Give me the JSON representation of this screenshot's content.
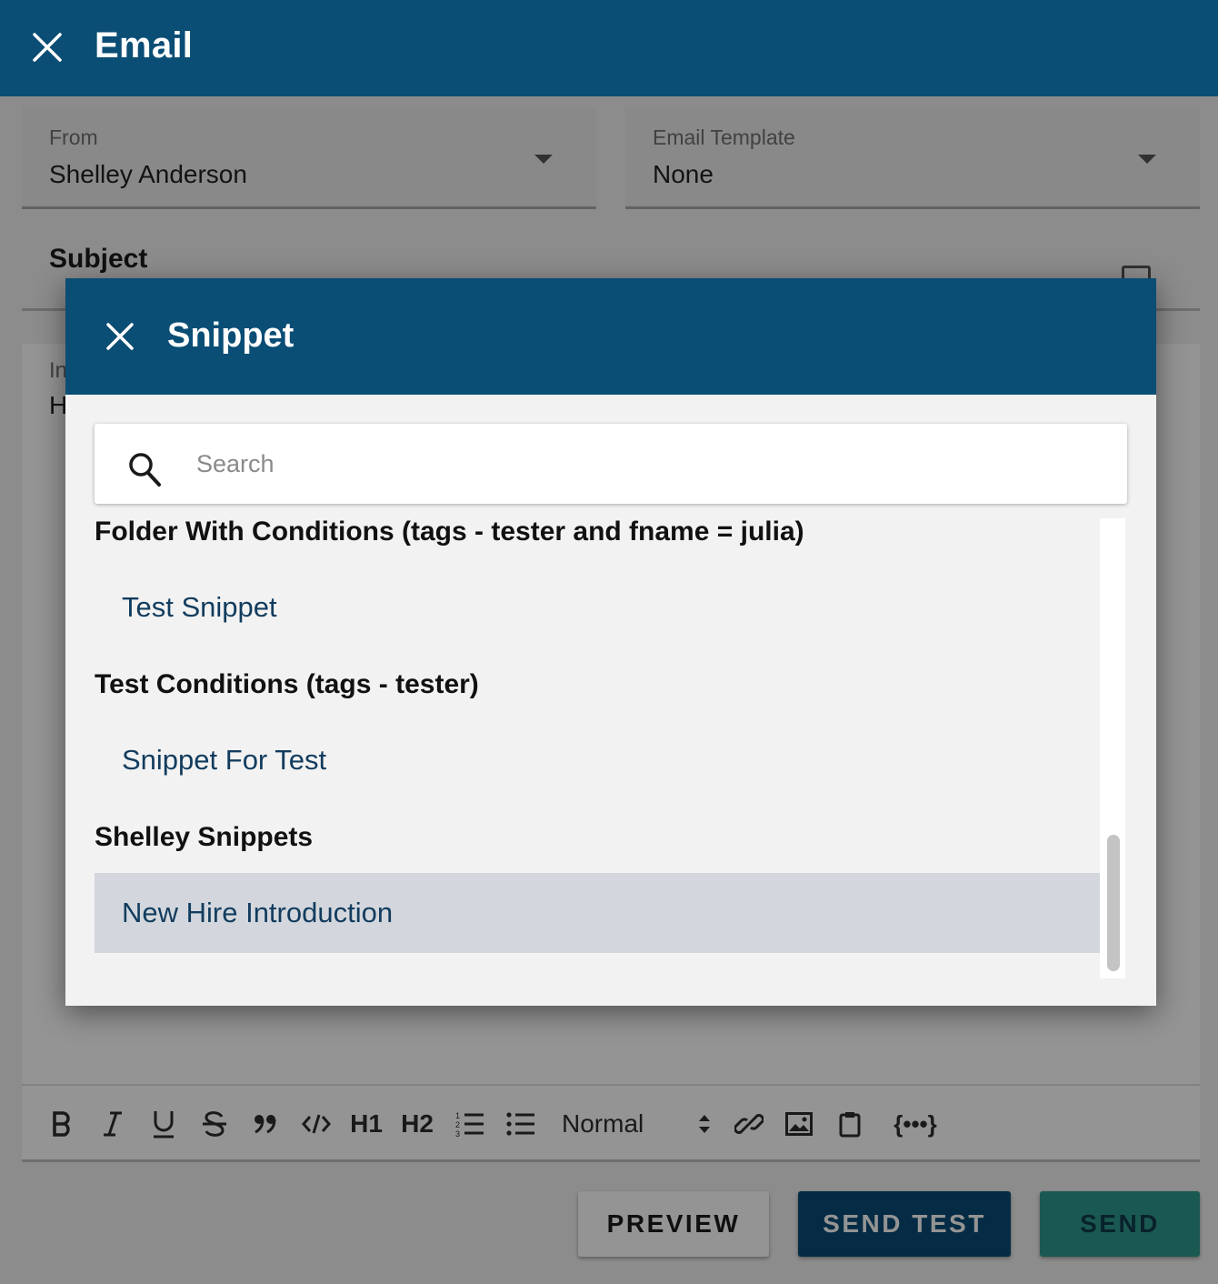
{
  "header": {
    "title": "Email"
  },
  "from": {
    "label": "From",
    "value": "Shelley Anderson"
  },
  "email_template": {
    "label": "Email Template",
    "value": "None"
  },
  "subject": {
    "label": "Subject"
  },
  "body": {
    "label": "In",
    "value": "H"
  },
  "toolbar": {
    "heading1": "H1",
    "heading2": "H2",
    "format_select": "Normal",
    "variables": "{•••}"
  },
  "buttons": {
    "preview": "PREVIEW",
    "send_test": "SEND TEST",
    "send": "SEND"
  },
  "snippet_modal": {
    "title": "Snippet",
    "search_placeholder": "Search",
    "folders": [
      {
        "name": "Folder With Conditions (tags - tester and fname = julia)",
        "items": [
          "Test Snippet"
        ]
      },
      {
        "name": "Test Conditions (tags - tester)",
        "items": [
          "Snippet For Test"
        ]
      },
      {
        "name": "Shelley Snippets",
        "items": [
          "New Hire Introduction"
        ]
      }
    ],
    "highlighted_item": "New Hire Introduction"
  },
  "colors": {
    "primary": "#0a4d75",
    "send": "#2e9a8c",
    "highlight": "#d3d7dd"
  }
}
